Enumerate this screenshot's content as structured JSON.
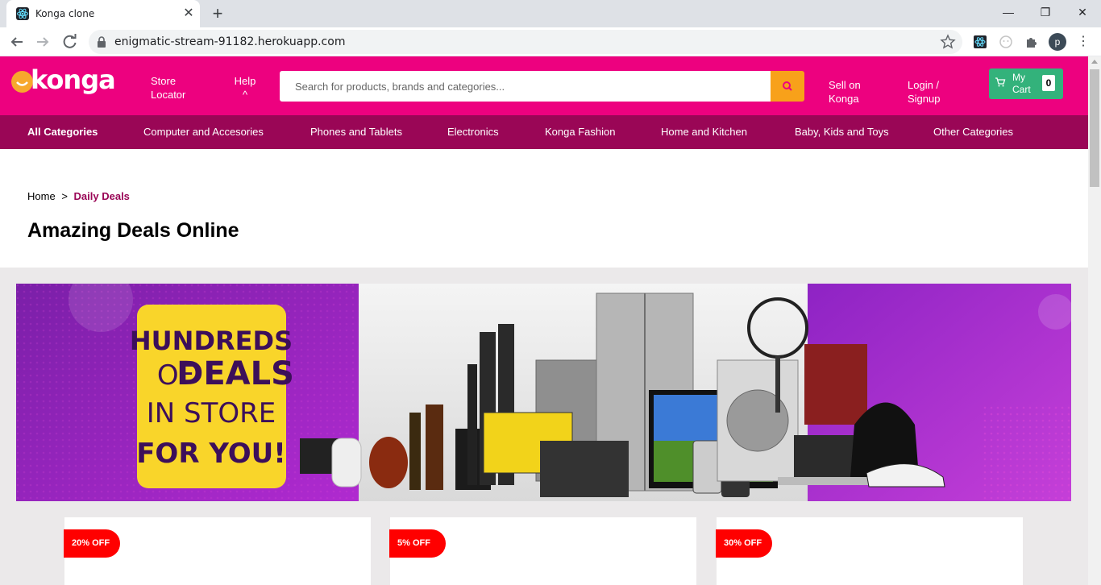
{
  "browser": {
    "tab_title": "Konga clone",
    "url": "enigmatic-stream-91182.herokuapp.com",
    "profile_initial": "p",
    "new_tab": "+",
    "close": "✕",
    "minimize": "—",
    "restore": "❐",
    "window_close": "✕"
  },
  "header": {
    "logo_text": "konga",
    "store_locator": "Store Locator",
    "help": "Help",
    "help_caret": "^",
    "search_placeholder": "Search for products, brands and categories...",
    "sell": "Sell on Konga",
    "login": "Login / Signup",
    "cart_label": "My Cart",
    "cart_count": "0"
  },
  "categories": [
    "All Categories",
    "Computer and Accesories",
    "Phones and Tablets",
    "Electronics",
    "Konga Fashion",
    "Home and Kitchen",
    "Baby, Kids and Toys",
    "Other Categories"
  ],
  "breadcrumb": {
    "home": "Home",
    "separator": ">",
    "current": "Daily Deals"
  },
  "page_title": "Amazing Deals Online",
  "banner": {
    "line1": "HUNDREDS",
    "line2_a": "OF",
    "line2_b": "DEALS",
    "line3": "IN STORE",
    "line4": "FOR YOU!"
  },
  "deals": [
    {
      "badge": "20% OFF"
    },
    {
      "badge": "5% OFF"
    },
    {
      "badge": "30% OFF"
    }
  ],
  "colors": {
    "brand_pink": "#ed017f",
    "category_bar": "#9a0656",
    "search_button": "#f8a11a",
    "cart_green": "#33b27b",
    "badge_red": "#ff0000"
  }
}
